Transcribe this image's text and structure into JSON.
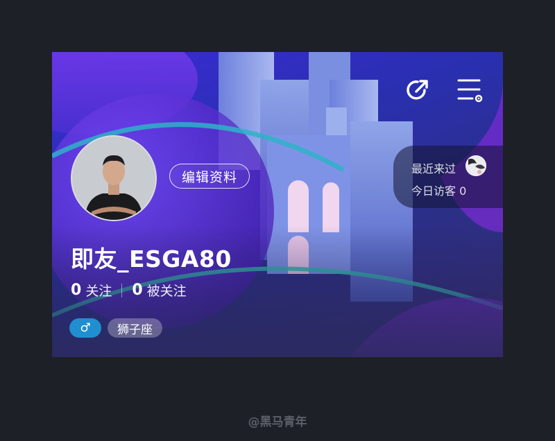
{
  "header": {
    "share_icon": "share-icon",
    "menu_icon": "menu-settings-icon"
  },
  "profile": {
    "edit_label": "编辑资料",
    "username": "即友_ESGA80",
    "following_count": "0",
    "following_label": "关注",
    "followers_count": "0",
    "followers_label": "被关注",
    "gender_symbol": "♂",
    "zodiac": "狮子座"
  },
  "visitors": {
    "recent_label": "最近来过",
    "today_label": "今日访客 0"
  },
  "watermark": "@黑马青年",
  "colors": {
    "gender_tag": "#1f8fd0",
    "page_background": "#1d2027"
  }
}
